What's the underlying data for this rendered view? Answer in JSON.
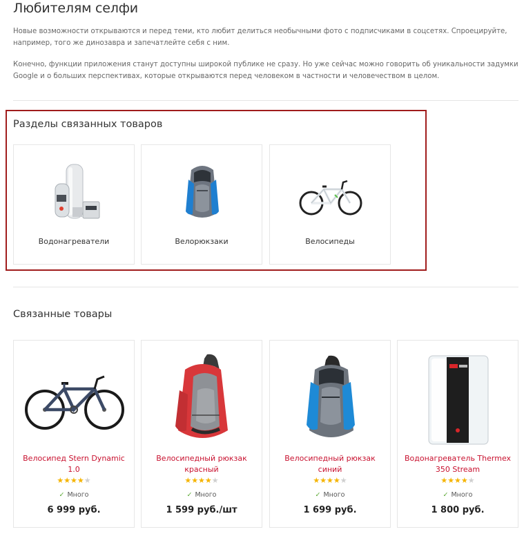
{
  "article": {
    "title": "Любителям селфи",
    "paragraph1": "Новые возможности открываются и перед теми, кто любит делиться необычными фото с подписчиками в соцсетях. Спроецируйте, например, того же динозавра и запечатлейте себя с ним.",
    "paragraph2": "Конечно, функции приложения станут доступны широкой публике не сразу. Но уже сейчас можно говорить об уникальности задумки Google и о больших перспективах, которые открываются перед человеком в частности и человечеством в целом."
  },
  "sections": {
    "title": "Разделы связанных товаров",
    "items": [
      {
        "label": "Водонагреватели",
        "icon": "water-heaters-image"
      },
      {
        "label": "Велорюкзаки",
        "icon": "backpack-image"
      },
      {
        "label": "Велосипеды",
        "icon": "bicycle-image"
      }
    ]
  },
  "related": {
    "title": "Связанные товары",
    "products": [
      {
        "name": "Велосипед Stern Dynamic 1.0",
        "rating": 4,
        "stock": "Много",
        "price": "6 999 руб.",
        "icon": "bicycle-image"
      },
      {
        "name": "Велосипедный рюкзак красный",
        "rating": 4,
        "stock": "Много",
        "price": "1 599 руб./шт",
        "icon": "red-backpack-image"
      },
      {
        "name": "Велосипедный рюкзак синий",
        "rating": 4,
        "stock": "Много",
        "price": "1 699 руб.",
        "icon": "blue-backpack-image"
      },
      {
        "name": "Водонагреватель Thermex 350 Stream",
        "rating": 4,
        "stock": "Много",
        "price": "1 800 руб.",
        "icon": "water-heater-image"
      }
    ]
  },
  "colors": {
    "accent_border": "#a01c1c",
    "product_link": "#c8102e",
    "star_on": "#f5b400",
    "star_off": "#cfcfcf",
    "stock_check": "#5aa832"
  }
}
